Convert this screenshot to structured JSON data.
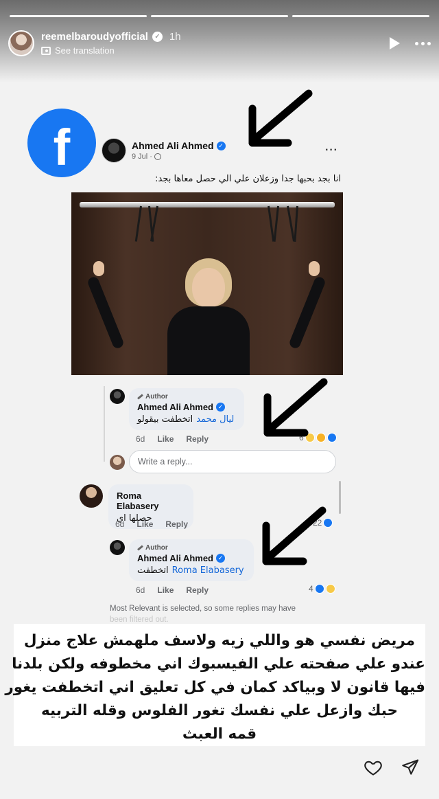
{
  "story": {
    "username": "reemelbaroudyofficial",
    "time": "1h",
    "translate_label": "See translation",
    "progress_segments": 3
  },
  "post": {
    "logo_letter": "f",
    "author": "Ahmed Ali Ahmed",
    "date": "9 Jul ·",
    "more": "···",
    "caption": "انا بجد بحبها جدا وزعلان علي الي حصل معاها بجد:"
  },
  "comments": [
    {
      "badge": "Author",
      "name": "Ahmed Ali Ahmed",
      "tag": "ليال محمد",
      "text": "اتخطفت بيقولو",
      "time": "6d",
      "like": "Like",
      "reply": "Reply",
      "reaction_count": "6"
    },
    {
      "name": "Roma Elabasery",
      "text": "حصلها اي",
      "time": "6d",
      "like": "Like",
      "reply": "Reply",
      "reaction_count": "22"
    },
    {
      "badge": "Author",
      "name": "Ahmed Ali Ahmed",
      "tag": "Roma Elabasery",
      "text": "اتخطفت",
      "time": "6d",
      "like": "Like",
      "reply": "Reply",
      "reaction_count": "4"
    }
  ],
  "write_reply_placeholder": "Write a reply...",
  "footnote": "Most Relevant is selected, so some replies may have",
  "footnote_cut": "been filtered out.",
  "overlay_lines": [
    "مريض نفسي هو واللي زيه ولاسف ملهمش علاج  منزل",
    "عندو علي صفحته علي الفيسبوك اني مخطوفه ولكن بلدنا",
    "فيها قانون لا وبياكد كمان في كل تعليق اني اتخطفت يغور",
    "حبك وازعل علي نفسك تغور الفلوس وقله التربيه",
    "قمه العبث"
  ],
  "colors": {
    "facebook_blue": "#1877f2",
    "tag_blue": "#1467d8",
    "bubble_bg": "#eaedf2"
  },
  "icons": [
    "verified-icon",
    "translate-icon",
    "play-icon",
    "more-icon",
    "facebook-logo",
    "globe-icon",
    "heart-icon",
    "send-icon",
    "arrow-icon"
  ]
}
